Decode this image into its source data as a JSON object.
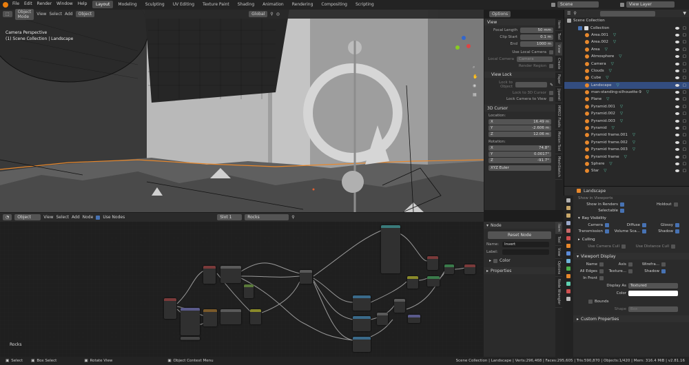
{
  "menu": [
    "File",
    "Edit",
    "Render",
    "Window",
    "Help"
  ],
  "workspaces": [
    "Layout",
    "Modeling",
    "Sculpting",
    "UV Editing",
    "Texture Paint",
    "Shading",
    "Animation",
    "Rendering",
    "Compositing",
    "Scripting"
  ],
  "scene": "Scene",
  "view_layer": "View Layer",
  "viewport": {
    "mode": "Object Mode",
    "menus": [
      "View",
      "Select",
      "Add",
      "Object"
    ],
    "orientation": "Global",
    "options": "Options",
    "overlay_title": "Camera Perspective",
    "overlay_sub": "(1) Scene Collection | Landscape"
  },
  "n_panel": {
    "view_header": "View",
    "focal_label": "Focal Length",
    "focal": "50 mm",
    "clip_label": "Clip Start",
    "clip": "0.1 m",
    "end_label": "End",
    "end": "1000 m",
    "use_local_camera": "Use Local Camera",
    "local_camera": "Local Camera",
    "camera_val": "Camera",
    "render_region": "Render Region",
    "view_lock": "View Lock",
    "lock_object": "Lock to Object",
    "lock_3d_cursor": "Lock to 3D Cursor",
    "lock_camera": "Lock Camera to View",
    "cursor_header": "3D Cursor",
    "location": "Location:",
    "loc_x": "16.49 m",
    "loc_y": "-2.606 m",
    "loc_z": "12.06 m",
    "rotation": "Rotation:",
    "rot_x": "74.8°",
    "rot_y": "0.0017°",
    "rot_z": "-91.7°",
    "rot_mode": "XYZ Euler",
    "axis_x": "X",
    "axis_y": "Y",
    "axis_z": "Z"
  },
  "viewport_tabs": [
    "Item",
    "Tool",
    "View",
    "Create",
    "Paper",
    "Jipanel",
    "MMO2 Fluids",
    "Motion Tool",
    "MeshSketch"
  ],
  "outliner": {
    "search_placeholder": "",
    "scene_collection": "Scene Collection",
    "collection": "Collection",
    "items": [
      "Area.001",
      "Area.002",
      "Area",
      "Atmosphere",
      "Camera",
      "Clouds",
      "Cube",
      "Landscape",
      "man-standing-silhouette-9",
      "Plane",
      "Pyramid.001",
      "Pyramid.002",
      "Pyramid.003",
      "Pyramid",
      "Pyramid frame.001",
      "Pyramid frame.002",
      "Pyramid frame.003",
      "Pyramid frame",
      "Sphere",
      "Star"
    ],
    "selected": "Landscape"
  },
  "properties": {
    "object": "Landscape",
    "show_viewports": "Show in Viewports",
    "show_renders": "Show in Renders",
    "holdout": "Holdout",
    "selectable": "Selectable",
    "ray_visibility": "Ray Visibility",
    "camera": "Camera",
    "diffuse": "Diffuse",
    "glossy": "Glossy",
    "transmission": "Transmission",
    "volume": "Volume Sca...",
    "shadow": "Shadow",
    "culling": "Culling",
    "use_camera_cull": "Use Camera Cull",
    "use_distance_cull": "Use Distance Cull",
    "viewport_display": "Viewport Display",
    "name": "Name",
    "axis": "Axis",
    "wireframe": "Wirefra...",
    "all_edges": "All Edges",
    "texture": "Texture...",
    "shadow2": "Shadow",
    "in_front": "In Front",
    "display_as_label": "Display As",
    "display_as": "Textured",
    "color": "Color",
    "bounds": "Bounds",
    "shape": "Shape",
    "shape_val": "Box",
    "custom_props": "Custom Properties"
  },
  "node_editor": {
    "type": "Object",
    "menus": [
      "View",
      "Select",
      "Add",
      "Node"
    ],
    "use_nodes": "Use Nodes",
    "slot": "Slot 1",
    "material": "Rocks",
    "label": "Rocks"
  },
  "node_panel": {
    "header": "Node",
    "reset": "Reset Node",
    "name_label": "Name:",
    "name_val": "Invert",
    "label_label": "Label:",
    "color": "Color",
    "properties": "Properties"
  },
  "node_tabs": [
    "Item",
    "Tool",
    "View",
    "Options",
    "Node Wrangler"
  ],
  "status": {
    "select": "Select",
    "box_select": "Box Select",
    "rotate": "Rotate View",
    "context": "Object Context Menu",
    "info": "Scene Collection | Landscape | Verts:296,468 | Faces:295,605 | Tris:590,870 | Objects:1/420 | Mem: 316.4 MiB | v2.81.16"
  },
  "colors": {
    "accent": "#4772b3",
    "selected_row": "#334d80",
    "orange": "#e8882c"
  }
}
